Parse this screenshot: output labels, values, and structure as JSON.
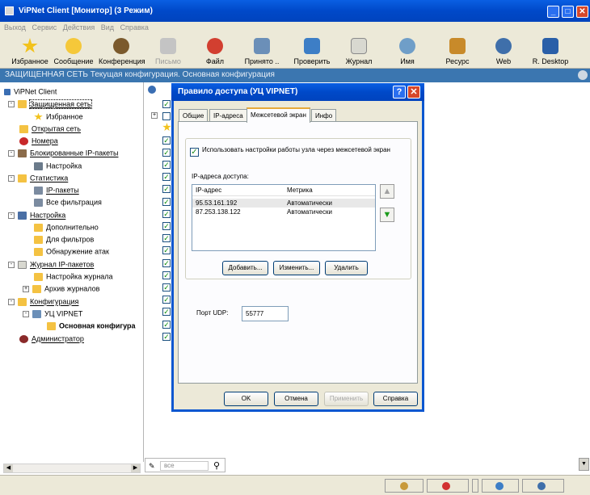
{
  "window": {
    "title": "ViPNet Client [Монитор] (3 Режим)",
    "btn_min": "_",
    "btn_max": "□",
    "btn_close": "✕"
  },
  "menu": [
    "Выход",
    "Сервис",
    "Действия",
    "Вид",
    "Справка"
  ],
  "toolbar": [
    {
      "label": "Избранное",
      "icon": "star-icon",
      "color": "#f2c21c"
    },
    {
      "label": "Сообщение",
      "icon": "message-icon",
      "color": "#f5c83a"
    },
    {
      "label": "Конференция",
      "icon": "conference-icon",
      "color": "#7b5a2d"
    },
    {
      "label": "Письмо",
      "icon": "letter-icon",
      "color": "#b0b0b0"
    },
    {
      "label": "Файл",
      "icon": "file-icon",
      "color": "#d23f30"
    },
    {
      "label": "Принято ..",
      "icon": "received-icon",
      "color": "#6b8fb8"
    },
    {
      "label": "Проверить",
      "icon": "check-icon",
      "color": "#3d7ec6"
    },
    {
      "label": "Журнал",
      "icon": "journal-icon",
      "color": "#8a8a8a"
    },
    {
      "label": "Имя",
      "icon": "search-name-icon",
      "color": "#6f9ec8"
    },
    {
      "label": "Ресурс",
      "icon": "resource-icon",
      "color": "#c88a2a"
    },
    {
      "label": "Web",
      "icon": "web-icon",
      "color": "#3f6faa"
    },
    {
      "label": "R. Desktop",
      "icon": "remote-desktop-icon",
      "color": "#2a5fa8"
    }
  ],
  "infobar": "ЗАЩИЩЕННАЯ СЕТЬ Текущая конфигурация. Основная конфигурация",
  "tree": {
    "root": "ViPNet Client",
    "items": [
      {
        "label": "Защищенная сеть",
        "exp": "-"
      },
      {
        "label": "Избранное",
        "exp": ""
      },
      {
        "label": "Открытая сеть",
        "exp": ""
      },
      {
        "label": "Номера",
        "exp": ""
      },
      {
        "label": "Блокированные IP-пакеты",
        "exp": "-"
      },
      {
        "label": "Настройка",
        "exp": ""
      },
      {
        "label": "Статистика",
        "exp": "-"
      },
      {
        "label": "IP-пакеты",
        "exp": ""
      },
      {
        "label": "Все фильтрация",
        "exp": ""
      },
      {
        "label": "Настройка",
        "exp": "-"
      },
      {
        "label": "Дополнительно",
        "exp": ""
      },
      {
        "label": "Для фильтров",
        "exp": ""
      },
      {
        "label": "Обнаружение атак",
        "exp": ""
      },
      {
        "label": "Журнал IP-пакетов",
        "exp": "-"
      },
      {
        "label": "Настройка журнала",
        "exp": ""
      },
      {
        "label": "Архив журналов",
        "exp": "+"
      },
      {
        "label": "Конфигурация",
        "exp": "-"
      },
      {
        "label": "УЦ VIPNET",
        "exp": "-"
      },
      {
        "label": "Основная конфигура",
        "exp": ""
      },
      {
        "label": "Администратор",
        "exp": ""
      }
    ]
  },
  "search": {
    "placeholder": "все"
  },
  "dialog": {
    "title": "Правило доступа (УЦ VIPNET)",
    "help_btn": "?",
    "close_btn": "✕",
    "tabs": [
      "Общие",
      "IP-адреса",
      "Межсетевой экран",
      "Инфо"
    ],
    "checkbox_label": "Использовать настройки работы узла через межсетевой экран",
    "ip_list_label": "IP-адреса доступа:",
    "columns": [
      "IP-адрес",
      "Метрика"
    ],
    "rows": [
      {
        "ip": "95.53.161.192",
        "metric": "Автоматически"
      },
      {
        "ip": "87.253.138.122",
        "metric": "Автоматически"
      }
    ],
    "add_btn": "Добавить...",
    "edit_btn": "Изменить...",
    "delete_btn": "Удалить",
    "udp_label": "Порт UDP:",
    "udp_value": "55777",
    "ok_btn": "OK",
    "cancel_btn": "Отмена",
    "apply_btn": "Применить",
    "help_btn2": "Справка"
  }
}
